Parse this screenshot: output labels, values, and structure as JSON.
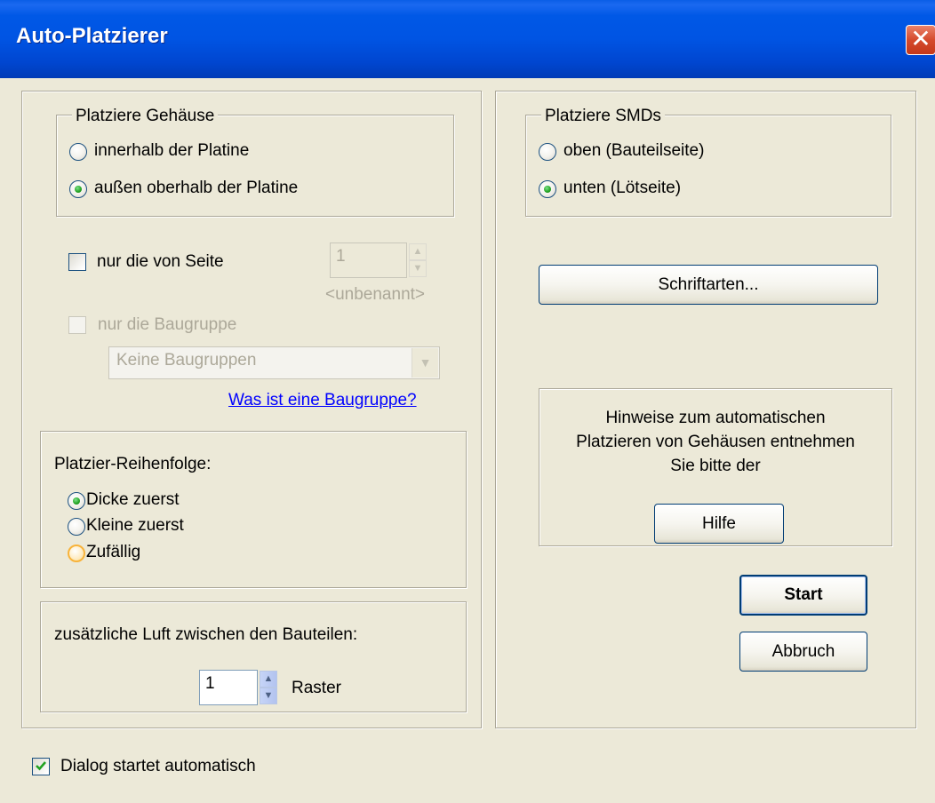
{
  "window": {
    "title": "Auto-Platzierer",
    "close_symbol": "✕"
  },
  "left": {
    "place_housing": {
      "legend": "Platziere Gehäuse",
      "option_inside": "innerhalb der Platine",
      "option_outside": "außen oberhalb der Platine",
      "selected": "option_outside"
    },
    "only_page": {
      "label": "nur die von Seite",
      "checked": false,
      "page_value": "1",
      "page_name": "<unbenannt>"
    },
    "only_group": {
      "label": "nur die Baugruppe",
      "checked": false,
      "enabled": false,
      "combo_value": "Keine Baugruppen",
      "help_link": "Was ist eine Baugruppe?"
    },
    "order": {
      "legend": "Platzier-Reihenfolge:",
      "options": [
        "Dicke zuerst",
        "Kleine zuerst",
        "Zufällig"
      ],
      "selected": "Dicke zuerst"
    },
    "spacing": {
      "label": "zusätzliche Luft zwischen den Bauteilen:",
      "value": "1",
      "unit": "Raster"
    }
  },
  "right": {
    "place_smd": {
      "legend": "Platziere SMDs",
      "option_top": "oben (Bauteilseite)",
      "option_bottom": "unten (Lötseite)",
      "selected": "option_bottom"
    },
    "fonts_button": "Schriftarten...",
    "hint": {
      "line1": "Hinweise zum automatischen",
      "line2": "Platzieren von Gehäusen entnehmen",
      "line3": "Sie bitte der",
      "help_button": "Hilfe"
    },
    "start_button": "Start",
    "cancel_button": "Abbruch"
  },
  "footer": {
    "auto_start_label": "Dialog startet automatisch",
    "auto_start_checked": true
  }
}
